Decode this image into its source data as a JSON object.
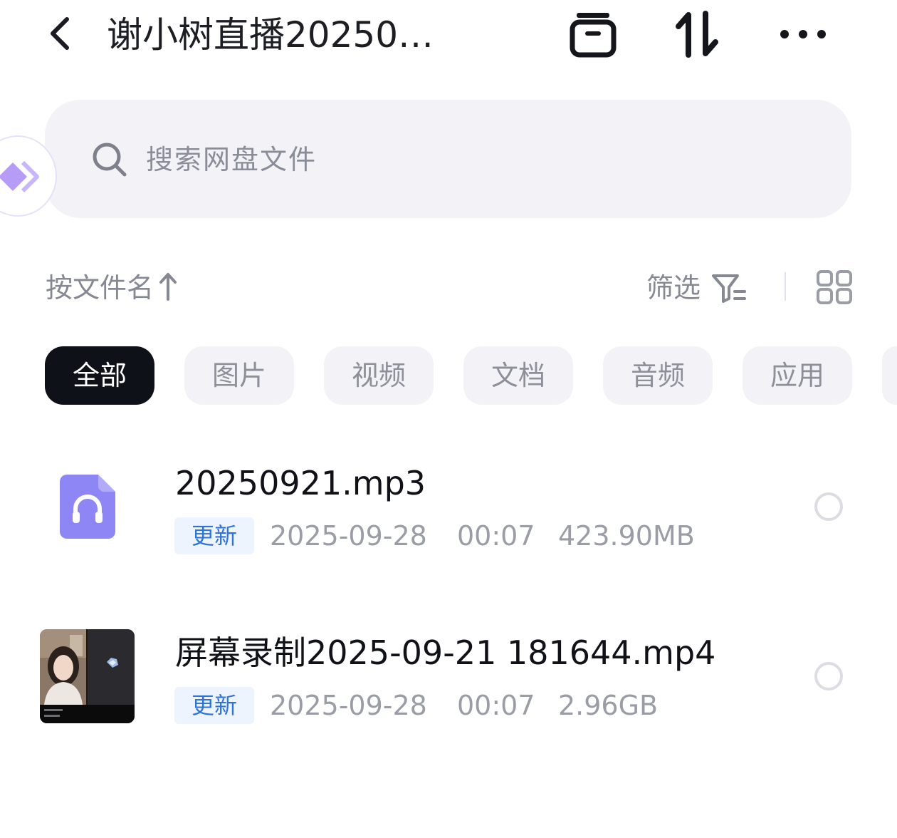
{
  "header": {
    "title": "谢小树直播20250…",
    "back_icon": "chevron-left-icon",
    "icons": [
      "archive-box-icon",
      "sort-arrows-icon",
      "more-dots-icon"
    ]
  },
  "search": {
    "placeholder": "搜索网盘文件"
  },
  "toolbar": {
    "sort_label": "按文件名",
    "filter_label": "筛选"
  },
  "categories": [
    {
      "label": "全部",
      "active": true
    },
    {
      "label": "图片",
      "active": false
    },
    {
      "label": "视频",
      "active": false
    },
    {
      "label": "文档",
      "active": false
    },
    {
      "label": "音频",
      "active": false
    },
    {
      "label": "应用",
      "active": false
    }
  ],
  "files": [
    {
      "name": "20250921.mp3",
      "badge": "更新",
      "date": "2025-09-28",
      "time": "00:07",
      "size": "423.90MB",
      "type_icon": "audio-file-icon"
    },
    {
      "name": "屏幕录制2025-09-21 181644.mp4",
      "badge": "更新",
      "date": "2025-09-28",
      "time": "00:07",
      "size": "2.96GB",
      "type_icon": "video-thumbnail"
    }
  ],
  "colors": {
    "accent_badge_text": "#2f73d9",
    "badge_bg": "#eef4fd",
    "chip_active_bg": "#0f1118",
    "chip_bg": "#f2f2f7",
    "audio_icon": "#8f86f5"
  }
}
